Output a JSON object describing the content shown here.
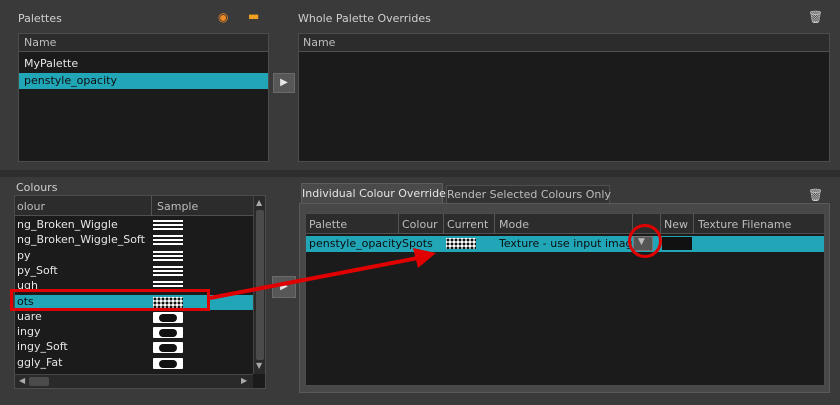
{
  "palettes": {
    "title": "Palettes",
    "column": "Name",
    "items": [
      "MyPalette",
      "penstyle_opacity"
    ],
    "selected_index": 1
  },
  "whole_overrides": {
    "title": "Whole Palette Overrides",
    "column": "Name"
  },
  "colours": {
    "title": "Colours",
    "columns": [
      "olour",
      "Sample"
    ],
    "items": [
      {
        "name": "ng_Broken_Wiggle",
        "sample": "stripes"
      },
      {
        "name": "ng_Broken_Wiggle_Soft",
        "sample": "stripes"
      },
      {
        "name": "py",
        "sample": "stripes"
      },
      {
        "name": "py_Soft",
        "sample": "stripes"
      },
      {
        "name": "ugh",
        "sample": "stripes"
      },
      {
        "name": "ots",
        "sample": "dots"
      },
      {
        "name": "uare",
        "sample": "blob"
      },
      {
        "name": "ingy",
        "sample": "blob"
      },
      {
        "name": "ingy_Soft",
        "sample": "blob"
      },
      {
        "name": "ggly_Fat",
        "sample": "blob"
      }
    ],
    "selected_index": 5
  },
  "overrides": {
    "tabs": [
      "Individual Colour Overrides",
      "Render Selected Colours Only"
    ],
    "active_tab": 0,
    "columns": [
      "Palette",
      "Colour",
      "Current",
      "Mode",
      "",
      "New",
      "Texture Filename"
    ],
    "row": {
      "palette": "penstyle_opacity",
      "colour": "Spots",
      "mode": "Texture - use input image"
    }
  },
  "icons": {
    "palette_add": "palette-icon",
    "folder": "folder-icon",
    "trash": "trash-icon"
  },
  "colors": {
    "selection": "#21a6b8",
    "annotation": "#e00000"
  }
}
